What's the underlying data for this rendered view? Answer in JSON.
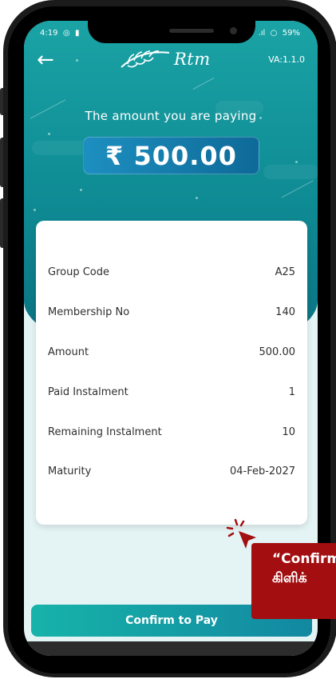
{
  "status": {
    "time": "4:19",
    "battery": "59%"
  },
  "header": {
    "logo_text": "Rtm",
    "version": "VA:1.1.0"
  },
  "payment": {
    "title": "The amount you are paying",
    "amount": "₹ 500.00"
  },
  "details": [
    {
      "label": "Group Code",
      "value": "A25"
    },
    {
      "label": "Membership No",
      "value": "140"
    },
    {
      "label": "Amount",
      "value": "500.00"
    },
    {
      "label": "Paid Instalment",
      "value": "1"
    },
    {
      "label": "Remaining Instalment",
      "value": "10"
    },
    {
      "label": "Maturity",
      "value": "04-Feb-2027"
    }
  ],
  "actions": {
    "confirm_label": "Confirm to Pay"
  },
  "tooltip": {
    "line1": "“Confirm",
    "line2": "கிளிக்"
  },
  "colors": {
    "primary": "#1aa3a5",
    "amount_box": "#1d8fc0",
    "tooltip": "#a30e10"
  },
  "icons": {
    "back": "arrow-left-icon",
    "click": "cursor-click-icon"
  }
}
